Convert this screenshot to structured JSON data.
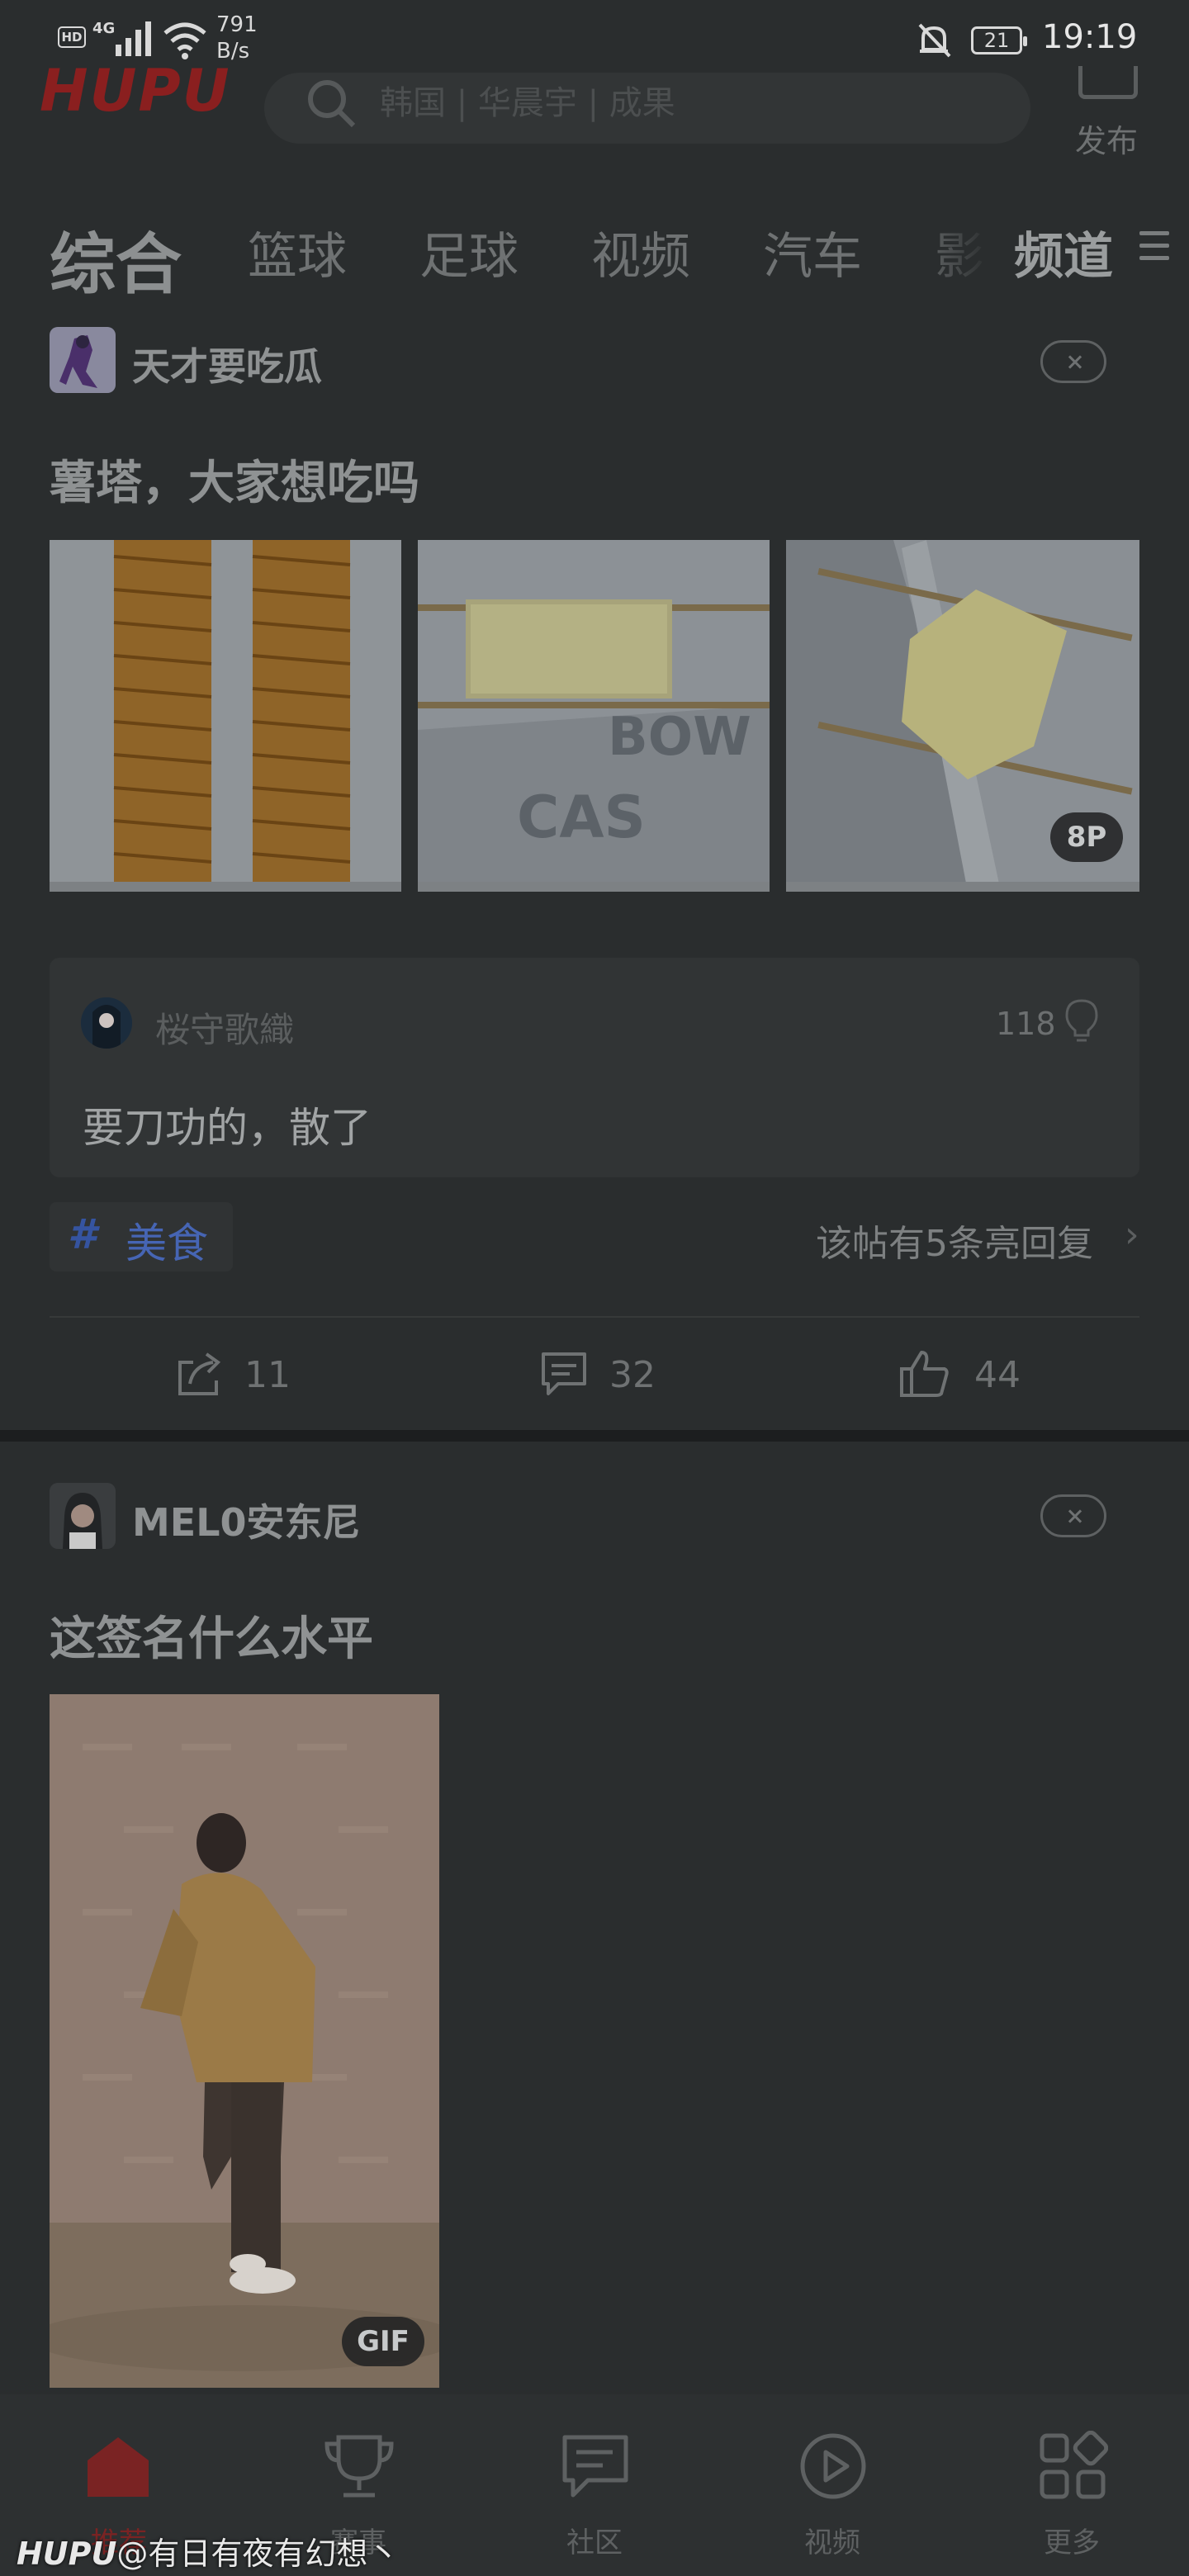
{
  "status_bar": {
    "hd": "HD",
    "network": "4G",
    "speed": "791\nB/s",
    "battery": "21",
    "time": "19:19"
  },
  "header": {
    "logo": "HUPU",
    "search_placeholder": "韩国 | 华晨宇 | 成果",
    "publish_label": "发布"
  },
  "tabs": [
    {
      "label": "综合",
      "active": true
    },
    {
      "label": "篮球"
    },
    {
      "label": "足球"
    },
    {
      "label": "视频"
    },
    {
      "label": "汽车"
    },
    {
      "label": "影"
    }
  ],
  "channel_label": "频道",
  "posts": [
    {
      "username": "天才要吃瓜",
      "title": "薯塔，大家想吃吗",
      "image_badge": "8P",
      "top_comment": {
        "username": "桜守歌織",
        "likes": "118",
        "text": "要刀功的，散了"
      },
      "tag": {
        "hash": "#",
        "label": "美食"
      },
      "replies_link": "该帖有5条亮回复",
      "actions": {
        "share": "11",
        "comments": "32",
        "likes": "44"
      }
    },
    {
      "username": "MEL0安东尼",
      "title": "这签名什么水平",
      "image_badge": "GIF"
    }
  ],
  "bottom_nav": [
    {
      "label": "推荐",
      "icon": "home-icon",
      "active": true
    },
    {
      "label": "赛事",
      "icon": "trophy-icon"
    },
    {
      "label": "社区",
      "icon": "chat-icon"
    },
    {
      "label": "视频",
      "icon": "play-icon"
    },
    {
      "label": "更多",
      "icon": "grid-icon"
    }
  ],
  "watermark": {
    "brand": "HUPU",
    "text": "@有日有夜有幻想丶"
  },
  "colors": {
    "background": "#2a2d2e",
    "accent_red": "#8a1f1f",
    "tag_blue": "#4665b4"
  }
}
